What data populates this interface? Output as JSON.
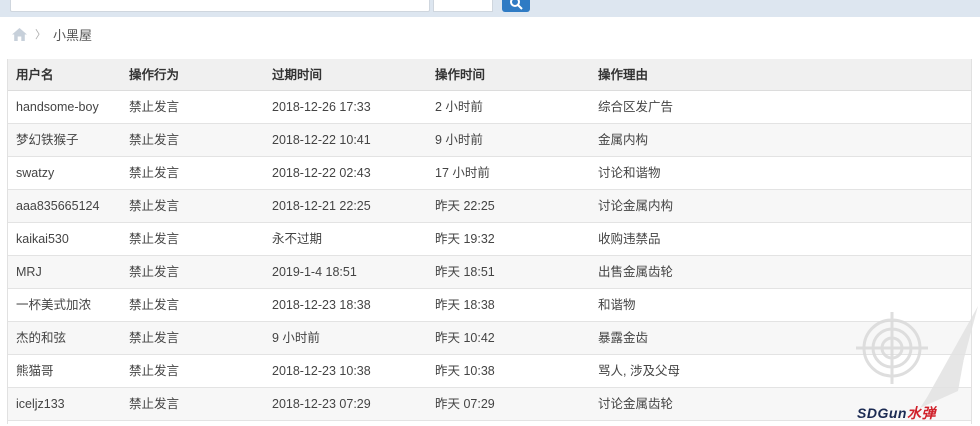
{
  "colors": {
    "accent": "#2f7bc4",
    "header_bg": "#f0f0f0",
    "topbar_bg": "#dde6f0"
  },
  "breadcrumb": {
    "home_icon": "home-icon",
    "current": "小黑屋"
  },
  "table": {
    "headers": [
      "用户名",
      "操作行为",
      "过期时间",
      "操作时间",
      "操作理由"
    ],
    "rows": [
      [
        "handsome-boy",
        "禁止发言",
        "2018-12-26 17:33",
        "2 小时前",
        "综合区发广告"
      ],
      [
        "梦幻铁猴子",
        "禁止发言",
        "2018-12-22 10:41",
        "9 小时前",
        "金属内构"
      ],
      [
        "swatzy",
        "禁止发言",
        "2018-12-22 02:43",
        "17 小时前",
        "讨论和谐物"
      ],
      [
        "aaa835665124",
        "禁止发言",
        "2018-12-21 22:25",
        "昨天 22:25",
        "讨论金属内构"
      ],
      [
        "kaikai530",
        "禁止发言",
        "永不过期",
        "昨天 19:32",
        "收购违禁品"
      ],
      [
        "MRJ",
        "禁止发言",
        "2019-1-4 18:51",
        "昨天 18:51",
        "出售金属齿轮"
      ],
      [
        "一杯美式加浓",
        "禁止发言",
        "2018-12-23 18:38",
        "昨天 18:38",
        "和谐物"
      ],
      [
        "杰的和弦",
        "禁止发言",
        "9 小时前",
        "昨天 10:42",
        "暴露金齿"
      ],
      [
        "熊猫哥",
        "禁止发言",
        "2018-12-23 10:38",
        "昨天 10:38",
        "骂人, 涉及父母"
      ],
      [
        "iceljz133",
        "禁止发言",
        "2018-12-23 07:29",
        "昨天 07:29",
        "讨论金属齿轮"
      ]
    ]
  },
  "watermark": {
    "brand": "SDGun",
    "brand_suffix": "水弹"
  }
}
